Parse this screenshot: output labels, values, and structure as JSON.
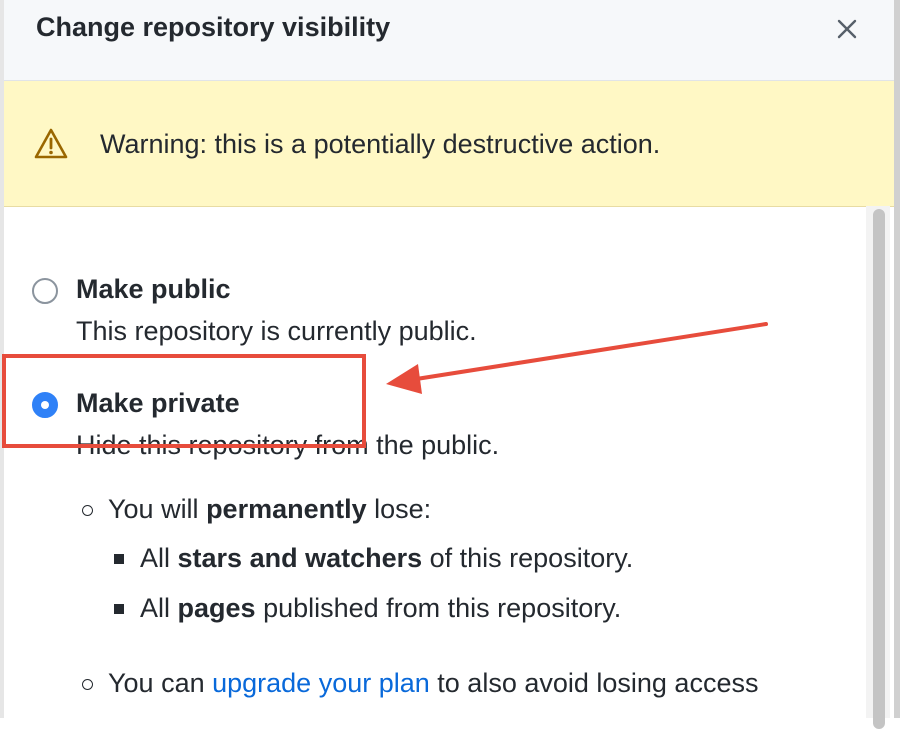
{
  "dialog": {
    "title": "Change repository visibility",
    "close_icon": "close-icon"
  },
  "warning": {
    "icon": "alert-triangle-icon",
    "text": "Warning: this is a potentially destructive action."
  },
  "options": {
    "public": {
      "label": "Make public",
      "description": "This repository is currently public.",
      "selected": false
    },
    "private": {
      "label": "Make private",
      "description": "Hide this repository from the public.",
      "selected": true
    }
  },
  "consequences": {
    "lose": {
      "prefix": "You will ",
      "emphasis": "permanently",
      "suffix": " lose:"
    },
    "lose_items": [
      {
        "prefix": "All ",
        "emphasis": "stars and watchers",
        "suffix": " of this repository."
      },
      {
        "prefix": "All ",
        "emphasis": "pages",
        "suffix": " published from this repository."
      }
    ],
    "upgrade": {
      "prefix": "You can ",
      "link": "upgrade your plan",
      "suffix": " to also avoid losing access"
    }
  },
  "colors": {
    "accent": "#2f81f7",
    "link": "#0969da",
    "warning_bg": "#fff8c5",
    "annotation": "#e74c3c"
  }
}
